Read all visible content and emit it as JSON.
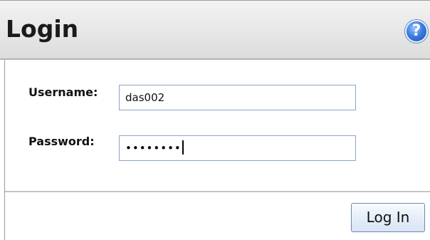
{
  "header": {
    "title": "Login",
    "help_icon": "help-icon",
    "help_glyph": "?"
  },
  "form": {
    "username_label": "Username:",
    "username_value": "das002",
    "password_label": "Password:",
    "password_value": "••••••••"
  },
  "footer": {
    "login_button_label": "Log In"
  },
  "colors": {
    "header_bg": "#e9e9e9",
    "help_icon_blue": "#3c7fe0",
    "input_border": "#8fa4c9",
    "button_border": "#6e86b3"
  }
}
